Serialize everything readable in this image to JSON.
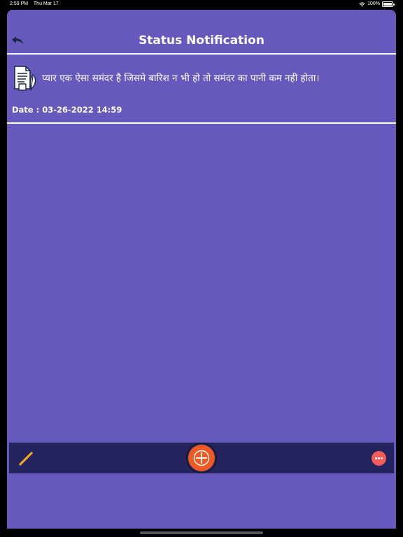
{
  "status_bar": {
    "time": "2:59 PM",
    "date": "Thu Mar 17",
    "battery": "100%"
  },
  "nav": {
    "title": "Status Notification",
    "back_icon": "back-arrow-icon"
  },
  "notification": {
    "icon": "document-feather-icon",
    "message": "प्यार एक ऐसा समंदर है जिसमे बारिश न भी हो तो समंदर का पानी कम नही होता।",
    "date": "Date : 03-26-2022 14:59"
  },
  "toolbar": {
    "edit_icon": "pencil-icon",
    "add_icon": "plus-icon",
    "more_icon": "more-dots-icon"
  },
  "colors": {
    "background": "#6658bc",
    "toolbar": "#23245e",
    "add_button": "#ee5a24",
    "more_button": "#f35b5b",
    "pencil": "#f5a623"
  }
}
